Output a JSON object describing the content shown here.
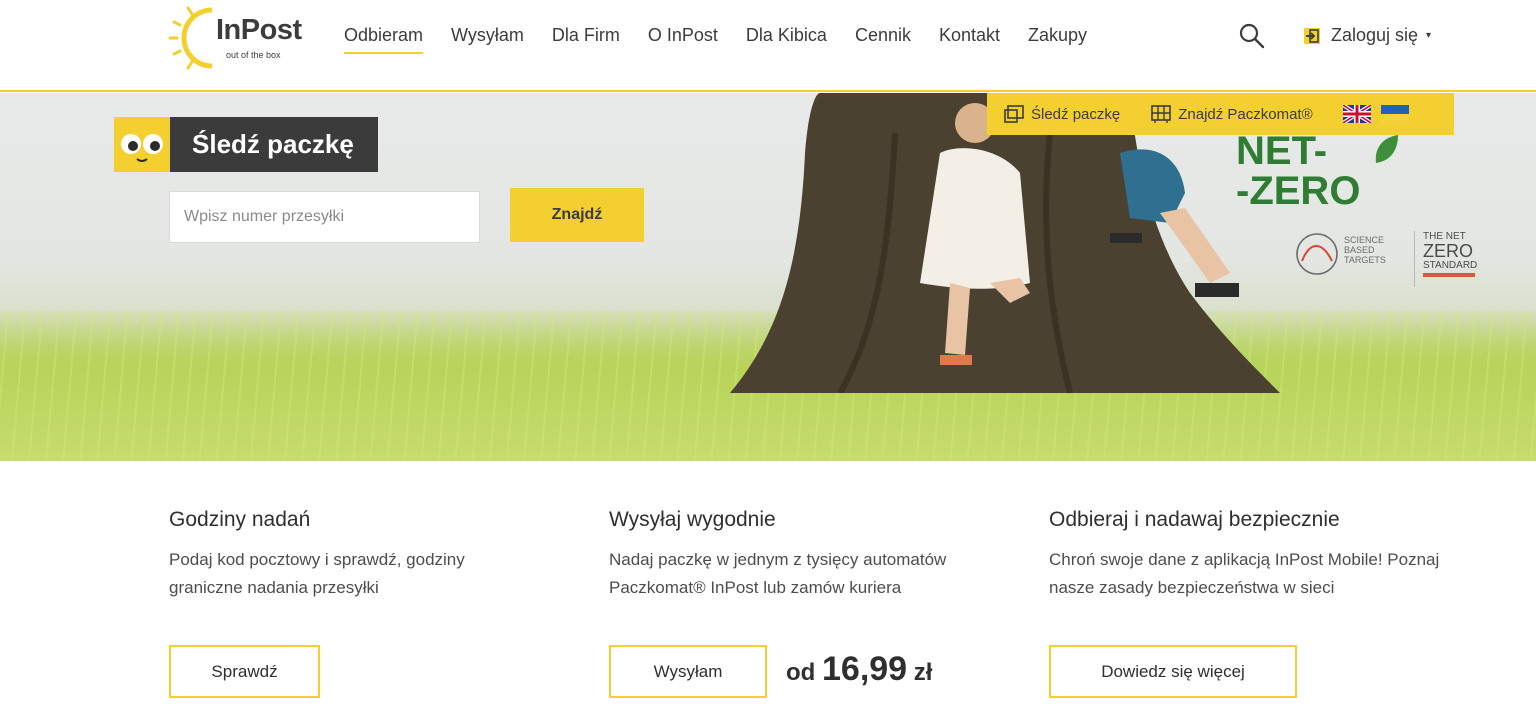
{
  "header": {
    "logo_text": "InPost",
    "logo_tagline": "out of the box",
    "nav": [
      {
        "label": "Odbieram"
      },
      {
        "label": "Wysyłam"
      },
      {
        "label": "Dla Firm"
      },
      {
        "label": "O InPost"
      },
      {
        "label": "Dla Kibica"
      },
      {
        "label": "Cennik"
      },
      {
        "label": "Kontakt"
      },
      {
        "label": "Zakupy"
      }
    ],
    "login_label": "Zaloguj się",
    "login_caret": "▾"
  },
  "hero": {
    "track_title": "Śledź paczkę",
    "input_placeholder": "Wpisz numer przesyłki",
    "find_button": "Znajdź",
    "quick_links": {
      "track": "Śledź paczkę",
      "find_locker": "Znajdź Paczkomat®"
    },
    "netzero_line1": "NET-",
    "netzero_line2": "-ZERO",
    "sbt_text": "SCIENCE BASED TARGETS",
    "nzs_top": "THE NET",
    "nzs_zero": "ZERO",
    "nzs_bottom": "STANDARD"
  },
  "columns": [
    {
      "title": "Godziny nadań",
      "text": "Podaj kod pocztowy i sprawdź, godziny graniczne nadania przesyłki",
      "button": "Sprawdź"
    },
    {
      "title": "Wysyłaj wygodnie",
      "text": "Nadaj paczkę w jednym z tysięcy automatów Paczkomat® InPost lub zamów kuriera",
      "button": "Wysyłam",
      "price_prefix": "od",
      "price_value": "16,99",
      "price_currency": "zł"
    },
    {
      "title": "Odbieraj i nadawaj bezpiecznie",
      "text": "Chroń swoje dane z aplikacją InPost Mobile! Poznaj nasze zasady bezpieczeństwa w sieci",
      "button": "Dowiedz się więcej"
    }
  ],
  "colors": {
    "brand_yellow": "#f3cf2f",
    "dark": "#3b3b3b",
    "netzero_green": "#2e7d32"
  },
  "icons": [
    "sun-logo-icon",
    "search-icon",
    "login-icon",
    "eyes-icon",
    "package-icon",
    "locker-icon",
    "uk-flag-icon",
    "ukraine-flag-icon",
    "leaf-icon",
    "sbt-logo-icon"
  ]
}
